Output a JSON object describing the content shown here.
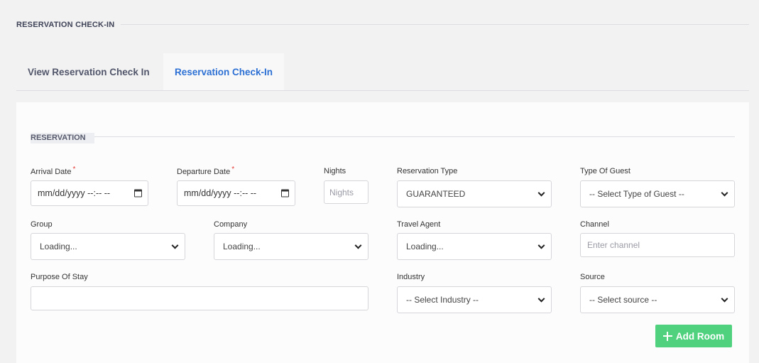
{
  "page": {
    "heading": "RESERVATION CHECK-IN"
  },
  "tabs": [
    {
      "label": "View Reservation Check In",
      "active": false
    },
    {
      "label": "Reservation Check-In",
      "active": true
    }
  ],
  "section": {
    "title": "RESERVATION"
  },
  "form": {
    "arrival_date": {
      "label": "Arrival Date",
      "required_mark": "*",
      "value": "mm/dd/yyyy --:-- --"
    },
    "departure_date": {
      "label": "Departure Date",
      "required_mark": "*",
      "value": "mm/dd/yyyy --:-- --"
    },
    "nights": {
      "label": "Nights",
      "placeholder": "Nights"
    },
    "reservation_type": {
      "label": "Reservation Type",
      "value": "GUARANTEED"
    },
    "type_of_guest": {
      "label": "Type Of Guest",
      "value": "-- Select Type of Guest --"
    },
    "group": {
      "label": "Group",
      "value": "Loading..."
    },
    "company": {
      "label": "Company",
      "value": "Loading..."
    },
    "travel_agent": {
      "label": "Travel Agent",
      "value": "Loading..."
    },
    "channel": {
      "label": "Channel",
      "placeholder": "Enter channel"
    },
    "purpose_of_stay": {
      "label": "Purpose Of Stay",
      "value": ""
    },
    "industry": {
      "label": "Industry",
      "value": "-- Select Industry --"
    },
    "source": {
      "label": "Source",
      "value": "-- Select source --"
    }
  },
  "actions": {
    "add_room_label": "Add Room"
  },
  "colors": {
    "accent": "#2c70d4",
    "add_button": "#4fd17e",
    "required": "#e53935"
  }
}
